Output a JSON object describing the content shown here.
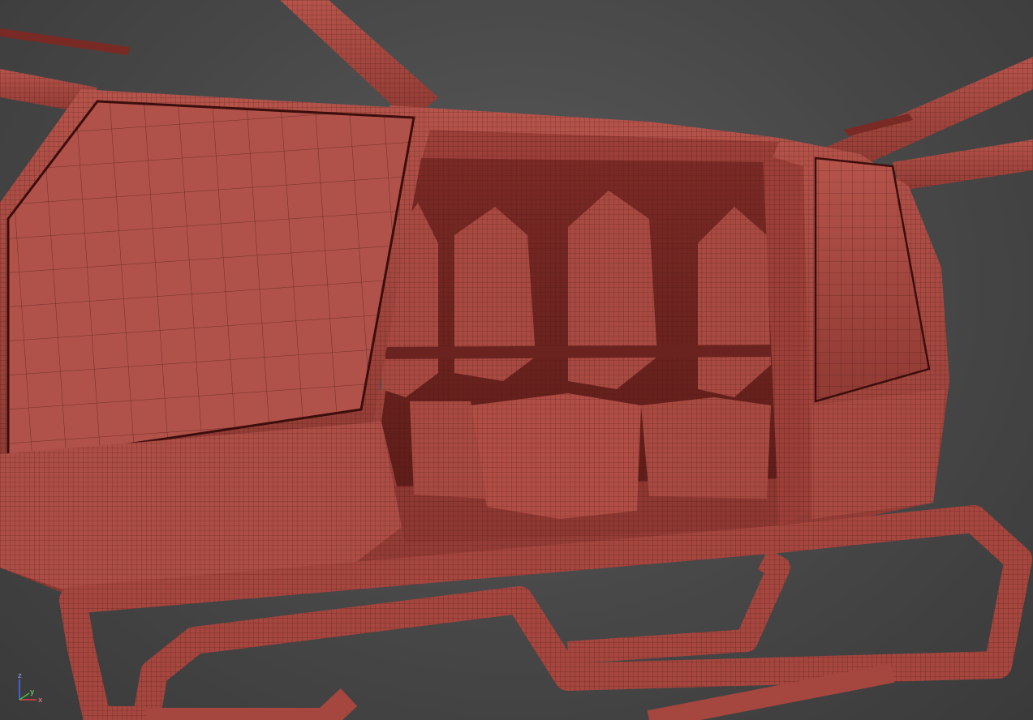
{
  "viewport": {
    "background_color": "#4a4a4a",
    "mesh_color": "#a5463f",
    "wire_color": "#3b0e0c"
  },
  "axis_gizmo": {
    "x_label": "x",
    "y_label": "y",
    "z_label": "z",
    "x_color": "#e04040",
    "y_color": "#40c040",
    "z_color": "#4070ff"
  }
}
